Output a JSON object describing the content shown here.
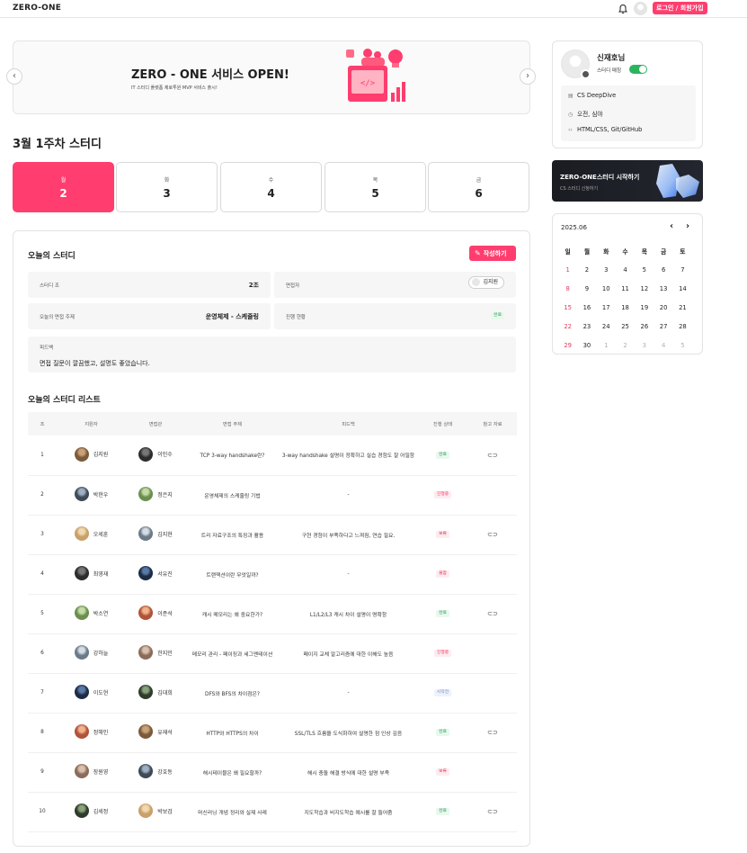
{
  "header": {
    "logo": "ZERO-ONE",
    "login_label": "로그인 / 회원가입"
  },
  "banner": {
    "title": "ZERO - ONE 서비스 OPEN!",
    "subtitle": "IT 스터디 플랫폼 제로투원 MVP 서비스 출시!"
  },
  "week": {
    "title": "3월 1주차 스터디",
    "days": [
      {
        "name": "월",
        "date": "2",
        "active": true
      },
      {
        "name": "화",
        "date": "3"
      },
      {
        "name": "수",
        "date": "4"
      },
      {
        "name": "목",
        "date": "5"
      },
      {
        "name": "금",
        "date": "6"
      }
    ]
  },
  "today": {
    "title": "오늘의 스터디",
    "write_label": "작성하기",
    "group_label": "스터디 조",
    "group_value": "2조",
    "interviewer_label": "면접자",
    "interviewer_value": "김지원",
    "topic_label": "오늘의 면접 주제",
    "topic_value": "운영체제 - 스케줄링",
    "progress_label": "진행 현황",
    "progress_value": "완료",
    "feedback_label": "피드백",
    "feedback_value": "면접 질문이 깔끔했고, 설명도 좋았습니다."
  },
  "study_list": {
    "title": "오늘의 스터디 리스트",
    "columns": [
      "조",
      "지원자",
      "면접관",
      "면접 주제",
      "피드백",
      "진행 상태",
      "참고 자료"
    ],
    "rows": [
      {
        "group": "1",
        "applicant": "김지원",
        "interviewer": "이민수",
        "topic": "TCP 3-way handshake란?",
        "feedback": "3-way handshake 설명이 정확하고 실습 경험도 잘 어필함",
        "status": "완료",
        "status_type": "done",
        "link": true
      },
      {
        "group": "2",
        "applicant": "박현우",
        "interviewer": "정은지",
        "topic": "운영체제의 스케줄링 기법",
        "feedback": "-",
        "status": "진행중",
        "status_type": "prog",
        "link": false
      },
      {
        "group": "3",
        "applicant": "오세훈",
        "interviewer": "김지현",
        "topic": "트리 자료구조의 특징과 활용",
        "feedback": "구현 경험이 부족하다고 느껴짐, 연습 필요.",
        "status": "보류",
        "status_type": "hold",
        "link": true
      },
      {
        "group": "4",
        "applicant": "최영재",
        "interviewer": "서유진",
        "topic": "트랜잭션이란 무엇일까?",
        "feedback": "-",
        "status": "불참",
        "status_type": "hold",
        "link": false
      },
      {
        "group": "5",
        "applicant": "박소연",
        "interviewer": "이준석",
        "topic": "캐시 메모리는 왜 중요한가?",
        "feedback": "L1/L2/L3 캐시 차이 설명이 명확함",
        "status": "완료",
        "status_type": "done",
        "link": true
      },
      {
        "group": "6",
        "applicant": "강하늘",
        "interviewer": "한지민",
        "topic": "메모리 관리 - 페이징과 세그멘테이션",
        "feedback": "페이지 교체 알고리즘에 대한 이해도 높음",
        "status": "진행중",
        "status_type": "prog",
        "link": false
      },
      {
        "group": "7",
        "applicant": "이도현",
        "interviewer": "김대희",
        "topic": "DFS와 BFS의 차이점은?",
        "feedback": "-",
        "status": "시작전",
        "status_type": "start",
        "link": false
      },
      {
        "group": "8",
        "applicant": "정해인",
        "interviewer": "유재석",
        "topic": "HTTP와 HTTPS의 차이",
        "feedback": "SSL/TLS 흐름을 도식화하여 설명한 점 인상 깊음",
        "status": "완료",
        "status_type": "done",
        "link": true
      },
      {
        "group": "9",
        "applicant": "장원영",
        "interviewer": "강호동",
        "topic": "해시테이블은 왜 필요할까?",
        "feedback": "해시 충돌 해결 방식에 대한 설명 부족",
        "status": "보류",
        "status_type": "hold",
        "link": false
      },
      {
        "group": "10",
        "applicant": "김세정",
        "interviewer": "박보검",
        "topic": "머신러닝 개념 정리와 실제 사례",
        "feedback": "지도학습과 비지도학습 예시를 잘 들어줌",
        "status": "완료",
        "status_type": "done",
        "link": true
      }
    ]
  },
  "profile": {
    "name": "신재호님",
    "matching_label": "스터디 매칭",
    "items": [
      {
        "icon": "clipboard-icon",
        "text": "CS DeepDive"
      },
      {
        "icon": "clock-icon",
        "text": "오전, 심야"
      },
      {
        "icon": "code-icon",
        "text": "HTML/CSS, Git/GitHub"
      }
    ]
  },
  "promo": {
    "title": "ZERO-ONE스터디 시작하기",
    "subtitle": "CS 스터디 신청하기"
  },
  "calendar": {
    "month": "2025.06",
    "weekdays": [
      "일",
      "월",
      "화",
      "수",
      "목",
      "금",
      "토"
    ],
    "weeks": [
      [
        "1",
        "2",
        "3",
        "4",
        "5",
        "6",
        "7"
      ],
      [
        "8",
        "9",
        "10",
        "11",
        "12",
        "13",
        "14"
      ],
      [
        "15",
        "16",
        "17",
        "18",
        "19",
        "20",
        "21"
      ],
      [
        "22",
        "23",
        "24",
        "25",
        "26",
        "27",
        "28"
      ],
      [
        "29",
        "30",
        "1",
        "2",
        "3",
        "4",
        "5"
      ]
    ]
  }
}
